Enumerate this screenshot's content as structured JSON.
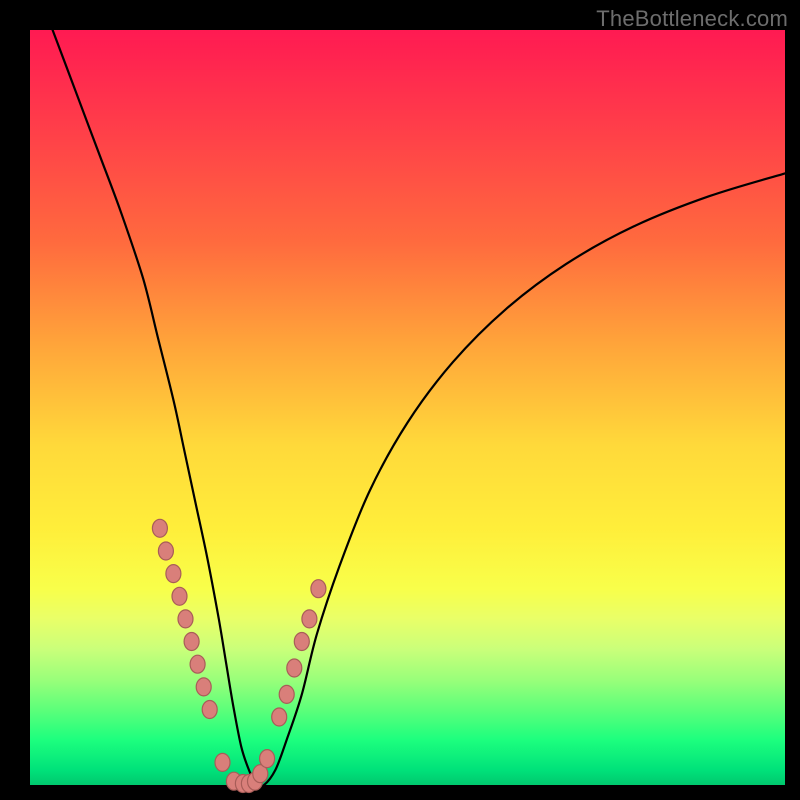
{
  "watermark": "TheBottleneck.com",
  "colors": {
    "gradient_top": "#ff1a52",
    "gradient_mid": "#ffd93a",
    "gradient_bottom": "#00c86e",
    "curve": "#000000",
    "bead_fill": "#d97f7a",
    "bead_stroke": "#a85d58",
    "background": "#000000"
  },
  "chart_data": {
    "type": "line",
    "title": "",
    "xlabel": "",
    "ylabel": "",
    "xlim": [
      0,
      100
    ],
    "ylim": [
      0,
      100
    ],
    "grid": false,
    "legend": false,
    "series": [
      {
        "name": "bottleneck-curve",
        "x": [
          3,
          6,
          9,
          12,
          15,
          17,
          19,
          20.5,
          22,
          23.5,
          25,
          26,
          27,
          28,
          29,
          30,
          31,
          32.5,
          34,
          36,
          38,
          41,
          45,
          50,
          56,
          63,
          71,
          80,
          90,
          100
        ],
        "y": [
          100,
          92,
          84,
          76,
          67,
          59,
          51,
          44,
          37,
          30,
          22,
          16,
          10,
          5,
          2,
          0,
          0,
          2,
          6,
          12,
          20,
          29,
          39,
          48,
          56,
          63,
          69,
          74,
          78,
          81
        ]
      }
    ],
    "markers": {
      "name": "highlight-beads",
      "x": [
        17.2,
        18.0,
        19.0,
        19.8,
        20.6,
        21.4,
        22.2,
        23.0,
        23.8,
        25.5,
        27.0,
        28.2,
        29.0,
        29.8,
        30.5,
        31.4,
        33.0,
        34.0,
        35.0,
        36.0,
        37.0,
        38.2
      ],
      "y": [
        34.0,
        31.0,
        28.0,
        25.0,
        22.0,
        19.0,
        16.0,
        13.0,
        10.0,
        3.0,
        0.5,
        0.2,
        0.2,
        0.5,
        1.5,
        3.5,
        9.0,
        12.0,
        15.5,
        19.0,
        22.0,
        26.0
      ]
    }
  }
}
